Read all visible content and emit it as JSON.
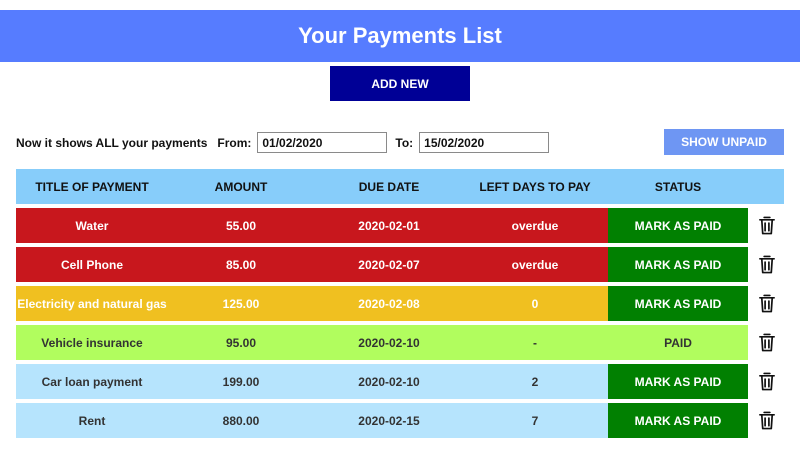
{
  "header": {
    "title": "Your Payments List"
  },
  "toolbar": {
    "add_new_label": "ADD NEW",
    "show_unpaid_label": "SHOW UNPAID"
  },
  "filter": {
    "description": "Now it shows ALL your payments",
    "from_label": "From:",
    "from_value": "01/02/2020",
    "to_label": "To:",
    "to_value": "15/02/2020"
  },
  "table": {
    "columns": [
      "TITLE OF PAYMENT",
      "AMOUNT",
      "DUE DATE",
      "LEFT DAYS TO PAY",
      "STATUS"
    ],
    "rows": [
      {
        "title": "Water",
        "amount": "55.00",
        "due_date": "2020-02-01",
        "left_days": "overdue",
        "status": "MARK AS PAID",
        "state": "overdue"
      },
      {
        "title": "Cell Phone",
        "amount": "85.00",
        "due_date": "2020-02-07",
        "left_days": "overdue",
        "status": "MARK AS PAID",
        "state": "overdue"
      },
      {
        "title": "Electricity and natural gas",
        "amount": "125.00",
        "due_date": "2020-02-08",
        "left_days": "0",
        "status": "MARK AS PAID",
        "state": "today"
      },
      {
        "title": "Vehicle insurance",
        "amount": "95.00",
        "due_date": "2020-02-10",
        "left_days": "-",
        "status": "PAID",
        "state": "paid"
      },
      {
        "title": "Car loan payment",
        "amount": "199.00",
        "due_date": "2020-02-10",
        "left_days": "2",
        "status": "MARK AS PAID",
        "state": "upcoming"
      },
      {
        "title": "Rent",
        "amount": "880.00",
        "due_date": "2020-02-15",
        "left_days": "7",
        "status": "MARK AS PAID",
        "state": "upcoming"
      }
    ]
  },
  "colors": {
    "header": "#567cff",
    "add_new": "#000096",
    "show_unpaid": "#6e96f3",
    "table_header": "#87cdfa",
    "overdue": "#c8171d",
    "due_today": "#f0c020",
    "paid": "#b1fd5e",
    "upcoming": "#b6e4fd",
    "mark_as_paid": "#018001"
  },
  "icons": {
    "delete": "trash-icon"
  }
}
